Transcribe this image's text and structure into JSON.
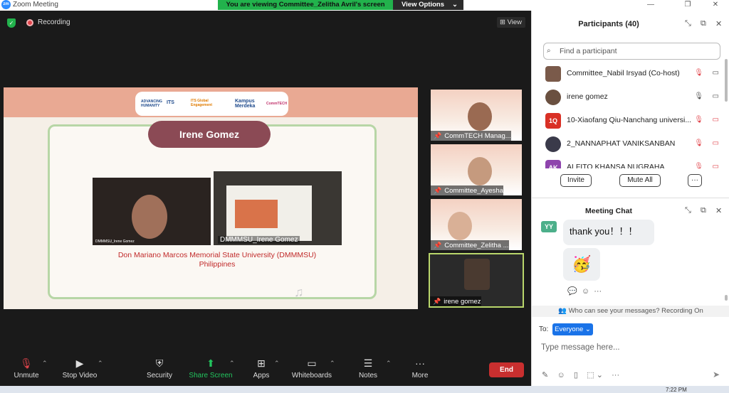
{
  "window": {
    "logo": "zm",
    "title": "Zoom Meeting",
    "minimize": "—",
    "restore": "❐",
    "close": "✕"
  },
  "banner": {
    "viewing_text": "You are viewing Committee_Zelitha Avril's screen",
    "view_options": "View Options"
  },
  "meeting": {
    "recording_label": "Recording",
    "view_label": "View"
  },
  "slide": {
    "logos": [
      "ADVANCING HUMANITY",
      "ITS",
      "ITS Global Engagement",
      "Kampus Merdeka",
      "CommTECH"
    ],
    "presenter_name": "Irene Gomez",
    "video_a_label": "DMMMSU_Irene Gomez",
    "video_b_label": "DMMMSU_Irene Gomez",
    "university_line1": "Don Mariano Marcos Memorial State University (DMMMSU)",
    "university_line2": "Philippines"
  },
  "thumbnails": [
    {
      "name": "CommTECH Manag..."
    },
    {
      "name": "Committee_Ayesha"
    },
    {
      "name": "Committee_Zelitha ..."
    },
    {
      "name": "irene gomez"
    }
  ],
  "toolbar": {
    "unmute": "Unmute",
    "stop_video": "Stop Video",
    "security": "Security",
    "share_screen": "Share Screen",
    "apps": "Apps",
    "whiteboards": "Whiteboards",
    "notes": "Notes",
    "more": "More",
    "end": "End"
  },
  "participants": {
    "title": "Participants (40)",
    "search_placeholder": "Find a participant",
    "list": [
      {
        "name": "Committee_Nabil Irsyad (Co-host)",
        "avatar": "",
        "avatar_color": "#7a5a4a"
      },
      {
        "name": "irene gomez",
        "avatar": "",
        "avatar_color": "#6a5040"
      },
      {
        "name": "10-Xiaofang Qiu-Nanchang universi...",
        "avatar": "1Q",
        "avatar_color": "#d93025"
      },
      {
        "name": "2_NANNAPHAT VANIKSANBAN",
        "avatar": "",
        "avatar_color": "#3a3a4a"
      },
      {
        "name": "ALFITO KHANSA NUGRAHA",
        "avatar": "AK",
        "avatar_color": "#8e44ad"
      }
    ],
    "invite": "Invite",
    "mute_all": "Mute All",
    "more": "···"
  },
  "chat": {
    "title": "Meeting Chat",
    "sender_initials": "YY",
    "message": "thank you！！！",
    "emoji": "🥳",
    "privacy": "Who can see your messages? Recording On",
    "to_label": "To:",
    "recipient": "Everyone",
    "input_placeholder": "Type message here..."
  },
  "taskbar": {
    "clock": "7:22 PM"
  }
}
